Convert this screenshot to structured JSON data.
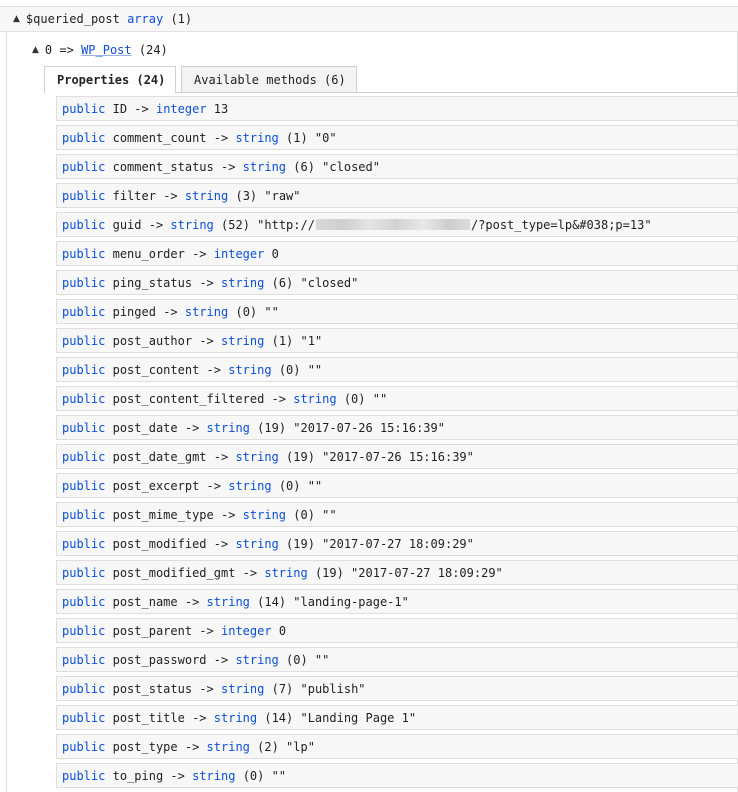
{
  "root": {
    "arrow": "▲",
    "name": "$queried_post",
    "type": "array",
    "count": "(1)"
  },
  "object": {
    "arrow": "▲",
    "key": "0 =>",
    "class_name": "WP_Post",
    "count": "(24)"
  },
  "tabs": [
    {
      "label": "Properties (24)"
    },
    {
      "label": "Available methods (6)"
    }
  ],
  "properties": [
    {
      "visibility": "public",
      "name": "ID",
      "arrow": "->",
      "type": "integer",
      "value": "13"
    },
    {
      "visibility": "public",
      "name": "comment_count",
      "arrow": "->",
      "type": "string",
      "value": "(1) \"0\""
    },
    {
      "visibility": "public",
      "name": "comment_status",
      "arrow": "->",
      "type": "string",
      "value": "(6) \"closed\""
    },
    {
      "visibility": "public",
      "name": "filter",
      "arrow": "->",
      "type": "string",
      "value": "(3) \"raw\""
    },
    {
      "visibility": "public",
      "name": "guid",
      "arrow": "->",
      "type": "string",
      "value": "(52) \"http://",
      "value_tail": "/?post_type=lp&#038;p=13\""
    },
    {
      "visibility": "public",
      "name": "menu_order",
      "arrow": "->",
      "type": "integer",
      "value": "0"
    },
    {
      "visibility": "public",
      "name": "ping_status",
      "arrow": "->",
      "type": "string",
      "value": "(6) \"closed\""
    },
    {
      "visibility": "public",
      "name": "pinged",
      "arrow": "->",
      "type": "string",
      "value": "(0) \"\""
    },
    {
      "visibility": "public",
      "name": "post_author",
      "arrow": "->",
      "type": "string",
      "value": "(1) \"1\""
    },
    {
      "visibility": "public",
      "name": "post_content",
      "arrow": "->",
      "type": "string",
      "value": "(0) \"\""
    },
    {
      "visibility": "public",
      "name": "post_content_filtered",
      "arrow": "->",
      "type": "string",
      "value": "(0) \"\""
    },
    {
      "visibility": "public",
      "name": "post_date",
      "arrow": "->",
      "type": "string",
      "value": "(19) \"2017-07-26 15:16:39\""
    },
    {
      "visibility": "public",
      "name": "post_date_gmt",
      "arrow": "->",
      "type": "string",
      "value": "(19) \"2017-07-26 15:16:39\""
    },
    {
      "visibility": "public",
      "name": "post_excerpt",
      "arrow": "->",
      "type": "string",
      "value": "(0) \"\""
    },
    {
      "visibility": "public",
      "name": "post_mime_type",
      "arrow": "->",
      "type": "string",
      "value": "(0) \"\""
    },
    {
      "visibility": "public",
      "name": "post_modified",
      "arrow": "->",
      "type": "string",
      "value": "(19) \"2017-07-27 18:09:29\""
    },
    {
      "visibility": "public",
      "name": "post_modified_gmt",
      "arrow": "->",
      "type": "string",
      "value": "(19) \"2017-07-27 18:09:29\""
    },
    {
      "visibility": "public",
      "name": "post_name",
      "arrow": "->",
      "type": "string",
      "value": "(14) \"landing-page-1\""
    },
    {
      "visibility": "public",
      "name": "post_parent",
      "arrow": "->",
      "type": "integer",
      "value": "0"
    },
    {
      "visibility": "public",
      "name": "post_password",
      "arrow": "->",
      "type": "string",
      "value": "(0) \"\""
    },
    {
      "visibility": "public",
      "name": "post_status",
      "arrow": "->",
      "type": "string",
      "value": "(7) \"publish\""
    },
    {
      "visibility": "public",
      "name": "post_title",
      "arrow": "->",
      "type": "string",
      "value": "(14) \"Landing Page 1\""
    },
    {
      "visibility": "public",
      "name": "post_type",
      "arrow": "->",
      "type": "string",
      "value": "(2) \"lp\""
    },
    {
      "visibility": "public",
      "name": "to_ping",
      "arrow": "->",
      "type": "string",
      "value": "(0) \"\""
    }
  ],
  "colors": {
    "keyword": "#0b4fd6",
    "row_background": "#f7f7f7",
    "border": "#dedede"
  }
}
